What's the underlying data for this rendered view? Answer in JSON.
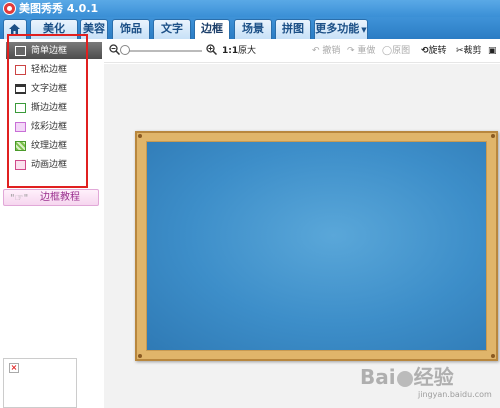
{
  "app": {
    "title": "美图秀秀 4.0.1"
  },
  "tabs": [
    {
      "label": "美化"
    },
    {
      "label": "美容"
    },
    {
      "label": "饰品"
    },
    {
      "label": "文字"
    },
    {
      "label": "边框",
      "active": true
    },
    {
      "label": "场景"
    },
    {
      "label": "拼图"
    },
    {
      "label": "更多功能"
    }
  ],
  "toolbar": {
    "zoom_ratio": "1:1",
    "original_size": "原大",
    "undo": "撤销",
    "redo": "重做",
    "restore": "原图",
    "rotate": "旋转",
    "crop": "裁剪",
    "more": "尺"
  },
  "sidebar": {
    "items": [
      {
        "label": "简单边框",
        "icon": "simple-frame-icon",
        "selected": true
      },
      {
        "label": "轻松边框",
        "icon": "easy-frame-icon"
      },
      {
        "label": "文字边框",
        "icon": "text-frame-icon"
      },
      {
        "label": "撕边边框",
        "icon": "torn-edge-frame-icon"
      },
      {
        "label": "炫彩边框",
        "icon": "colorful-frame-icon"
      },
      {
        "label": "纹理边框",
        "icon": "texture-frame-icon"
      },
      {
        "label": "动画边框",
        "icon": "animated-frame-icon"
      }
    ],
    "tutorial_label": "边框教程"
  },
  "watermark": {
    "text_left": "Bai",
    "text_right": "经验",
    "sub": "jingyan.baidu.com"
  },
  "colors": {
    "titlebar": "#3a8fd6",
    "highlight_box": "#e02020",
    "frame_wood": "#e0b56a",
    "frame_board": "#3d8ec9"
  }
}
